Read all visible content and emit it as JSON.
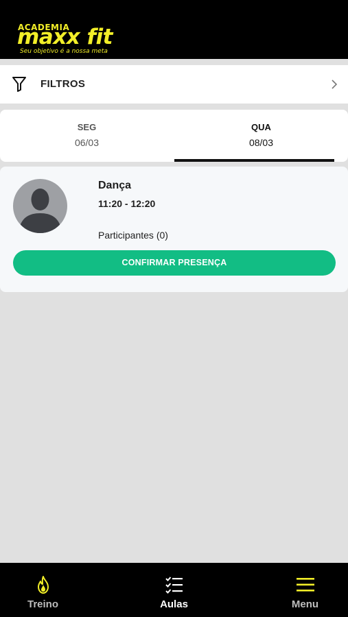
{
  "header": {
    "logo_small": "ACADEMIA",
    "logo_main": "maxx fit",
    "tagline": "Seu objetivo é a nossa meta",
    "accent_color": "#f2ee28"
  },
  "filters": {
    "icon": "filter-icon",
    "label": "FILTROS"
  },
  "days": [
    {
      "day": "SEG",
      "date": "06/03",
      "selected": false
    },
    {
      "day": "QUA",
      "date": "08/03",
      "selected": true
    }
  ],
  "class_card": {
    "title": "Dança",
    "time": "11:20 - 12:20",
    "participants": "Participantes (0)",
    "confirm_label": "CONFIRMAR PRESENÇA",
    "confirm_color": "#12bd84"
  },
  "bottom_nav": [
    {
      "label": "Treino",
      "icon": "flame-icon",
      "active": false
    },
    {
      "label": "Aulas",
      "icon": "checklist-icon",
      "active": true
    },
    {
      "label": "Menu",
      "icon": "hamburger-menu-icon",
      "active": false
    }
  ]
}
